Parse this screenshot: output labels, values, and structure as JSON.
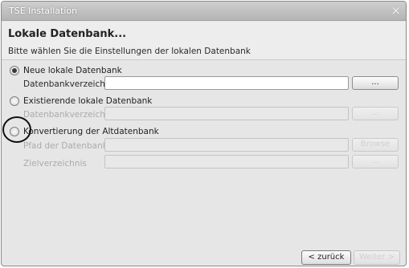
{
  "window": {
    "title": "TSE Installation",
    "close_glyph": "×"
  },
  "header": {
    "title": "Lokale Datenbank...",
    "subtitle": "Bitte wählen Sie die Einstellungen der lokalen Datenbank"
  },
  "options": {
    "new_db": {
      "label": "Neue lokale Datenbank",
      "selected": true,
      "field_label": "Datenbankverzeichnis",
      "field_value": "",
      "browse_label": "..."
    },
    "existing_db": {
      "label": "Existierende lokale Datenbank",
      "selected": false,
      "field_label": "Datenbankverzeichnis",
      "field_value": "",
      "browse_label": "..."
    },
    "convert_db": {
      "label": "Konvertierung der Altdatenbank",
      "selected": false,
      "path_label": "Pfad der Datenbank",
      "path_value": "",
      "path_browse_label": "Browse",
      "target_label": "Zielverzeichnis",
      "target_value": "",
      "target_browse_label": "..."
    }
  },
  "footer": {
    "back_label": "< zurück",
    "next_label": "Weiter >"
  }
}
